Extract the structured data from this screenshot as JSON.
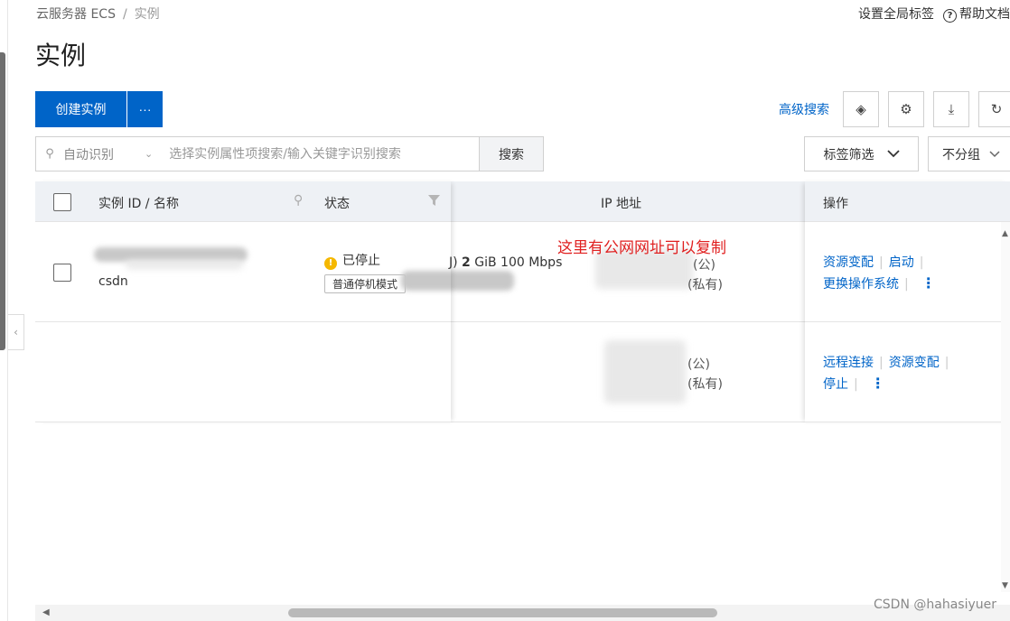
{
  "breadcrumb": {
    "root": "云服务器 ECS",
    "separator": "/",
    "current": "实例"
  },
  "header_actions": {
    "global_tags": "设置全局标签",
    "help": "帮助文档"
  },
  "page_title": "实例",
  "toolbar": {
    "create_label": "创建实例",
    "more_label": "···",
    "advanced_search": "高级搜索",
    "layers_icon": "◈",
    "settings_icon": "⚙",
    "download_icon": "⤓",
    "refresh_icon": "↻"
  },
  "search": {
    "mode": "自动识别",
    "placeholder": "选择实例属性项搜索/输入关键字识别搜索",
    "button": "搜索"
  },
  "filters": {
    "tag_filter": "标签筛选",
    "group": "不分组"
  },
  "table": {
    "headers": {
      "id_name": "实例 ID / 名称",
      "status": "状态",
      "ip": "IP 地址",
      "actions": "操作"
    },
    "rows": [
      {
        "name": "csdn",
        "status": "已停止",
        "stop_mode": "普通停机模式",
        "spec_prefix": "J)",
        "spec_mem": "2",
        "spec_rest": " GiB 100 Mbps",
        "ip_public": "(公)",
        "ip_private": "(私有)",
        "actions": [
          "资源变配",
          "启动",
          "更换操作系统"
        ]
      },
      {
        "name": "",
        "ip_public": "(公)",
        "ip_private": "(私有)",
        "actions": [
          "远程连接",
          "资源变配",
          "停止"
        ]
      }
    ]
  },
  "annotation": "这里有公网网址可以复制",
  "watermark": "CSDN @hahasiyuer",
  "colors": {
    "primary": "#0064c8",
    "annotation": "#e02020",
    "status_stopped": "#f5b800"
  }
}
